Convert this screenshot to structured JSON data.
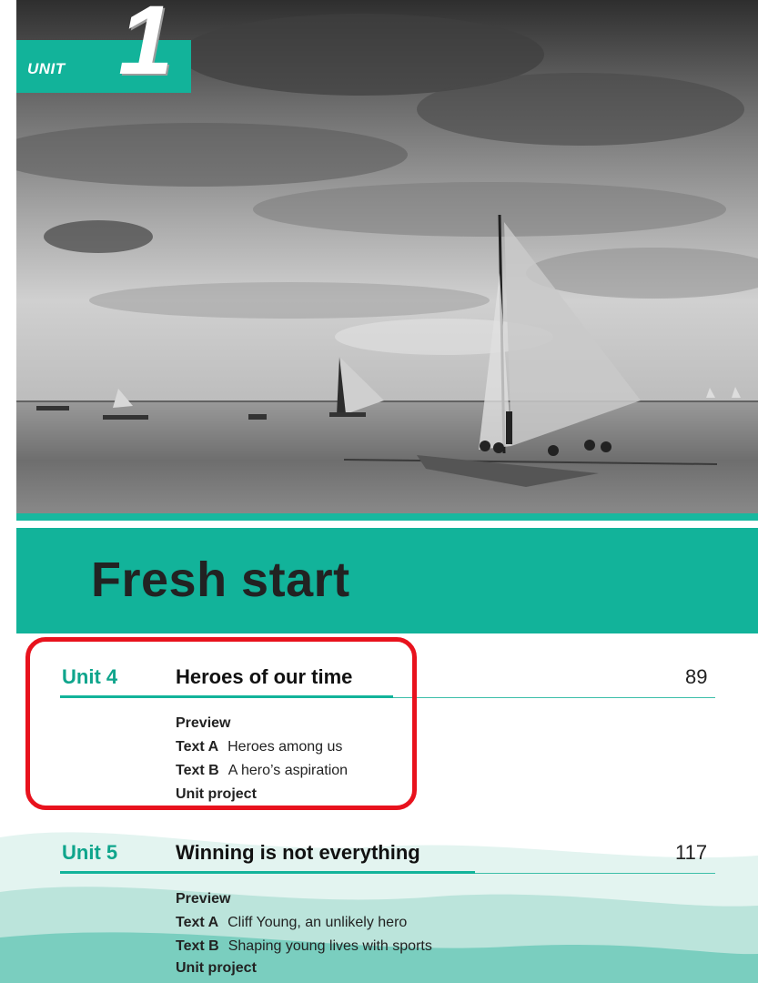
{
  "header": {
    "unit_word": "UNIT",
    "unit_number": "1"
  },
  "title": "Fresh start",
  "colors": {
    "accent": "#12b39a",
    "highlight": "#e8121d"
  },
  "toc": [
    {
      "label": "Unit 4",
      "title": "Heroes of our time",
      "page": "89",
      "preview": "Preview",
      "text_a_label": "Text A",
      "text_a": "Heroes among us",
      "text_b_label": "Text B",
      "text_b": "A hero’s aspiration",
      "project": "Unit project"
    },
    {
      "label": "Unit 5",
      "title": "Winning is not everything",
      "page": "117",
      "preview": "Preview",
      "text_a_label": "Text A",
      "text_a": "Cliff Young, an unlikely hero",
      "text_b_label": "Text B",
      "text_b": "Shaping young lives with sports",
      "project": "Unit project"
    }
  ]
}
